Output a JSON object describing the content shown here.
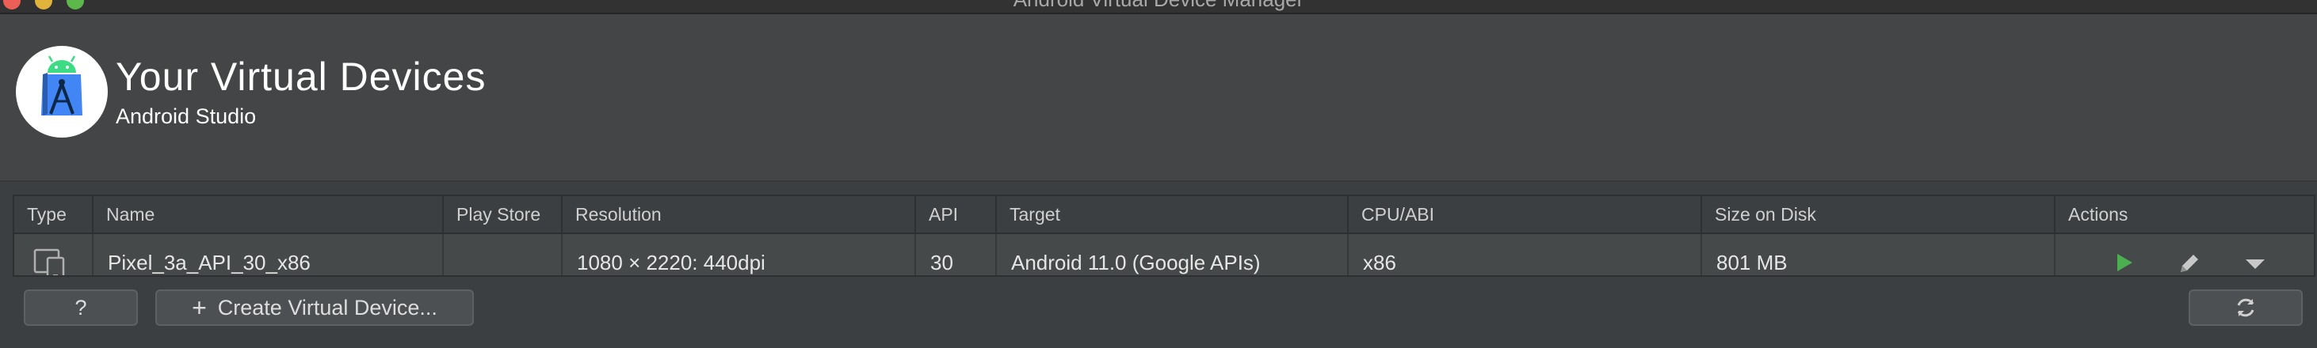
{
  "window": {
    "title": "Android Virtual Device Manager"
  },
  "header": {
    "title": "Your Virtual Devices",
    "subtitle": "Android Studio",
    "logo_icon": "android-studio-logo-icon"
  },
  "table": {
    "columns": [
      "Type",
      "Name",
      "Play Store",
      "Resolution",
      "API",
      "Target",
      "CPU/ABI",
      "Size on Disk",
      "Actions"
    ],
    "rows": [
      {
        "type_icon": "device-phone-tablet-icon",
        "name": "Pixel_3a_API_30_x86",
        "play_store": "",
        "resolution": "1080 × 2220: 440dpi",
        "api": "30",
        "target": "Android 11.0 (Google APIs)",
        "cpu_abi": "x86",
        "size_on_disk": "801 MB",
        "actions": [
          "play-icon",
          "pencil-icon",
          "dropdown-arrow-icon"
        ]
      }
    ]
  },
  "footer": {
    "help_label": "?",
    "create_label": "Create Virtual Device...",
    "create_icon": "plus-icon",
    "refresh_icon": "refresh-icon"
  },
  "colors": {
    "background": "#3c3f41",
    "header_background": "#434546",
    "row_background": "#45494a",
    "play_green": "#4caf50",
    "android_blue": "#4285f4",
    "android_green": "#3ddc84"
  }
}
